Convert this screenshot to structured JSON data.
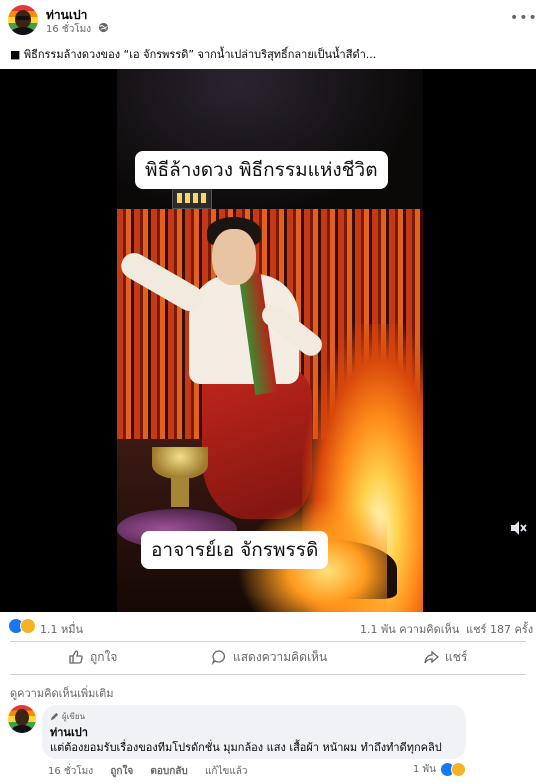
{
  "post": {
    "author": "ท่านเปา",
    "time": "16 ชั่วโมง",
    "text": "■ พิธีกรรมล้างดวงของ “เอ จักรพรรดิ” จากน้ำเปล่าบริสุทธิ์กลายเป็นน้ำสีดำ...",
    "video": {
      "caption_top": "พิธีล้างดวง พิธีกรรมแห่งชีวิต",
      "caption_bottom": "อาจารย์เอ จักรพรรดิ"
    }
  },
  "stats": {
    "reactions": "1.1 หมื่น",
    "comments": "1.1 พัน ความคิดเห็น",
    "shares": "แชร์ 187 ครั้ง"
  },
  "actions": {
    "like": "ถูกใจ",
    "comment": "แสดงความคิดเห็น",
    "share": "แชร์"
  },
  "comments_section": {
    "more_label": "ดูความคิดเห็นเพิ่มเติม",
    "comment": {
      "badge": "ผู้เขียน",
      "author": "ท่านเปา",
      "text": "แต่ต้องยอมรับเรื่องของทีมโปรดักชั่น มุมกล้อง แสง เสื้อผ้า หน้าผม ทำถึงทำดีทุกคลิป",
      "time": "16 ชั่วโมง",
      "like": "ถูกใจ",
      "reply": "ตอบกลับ",
      "edited": "แก้ไขแล้ว",
      "reaction_count": "1 พัน"
    }
  },
  "colors": {
    "accent": "#1877f2",
    "muted_text": "#65676b",
    "bubble": "#f0f2f5",
    "haha": "#f7b125"
  }
}
